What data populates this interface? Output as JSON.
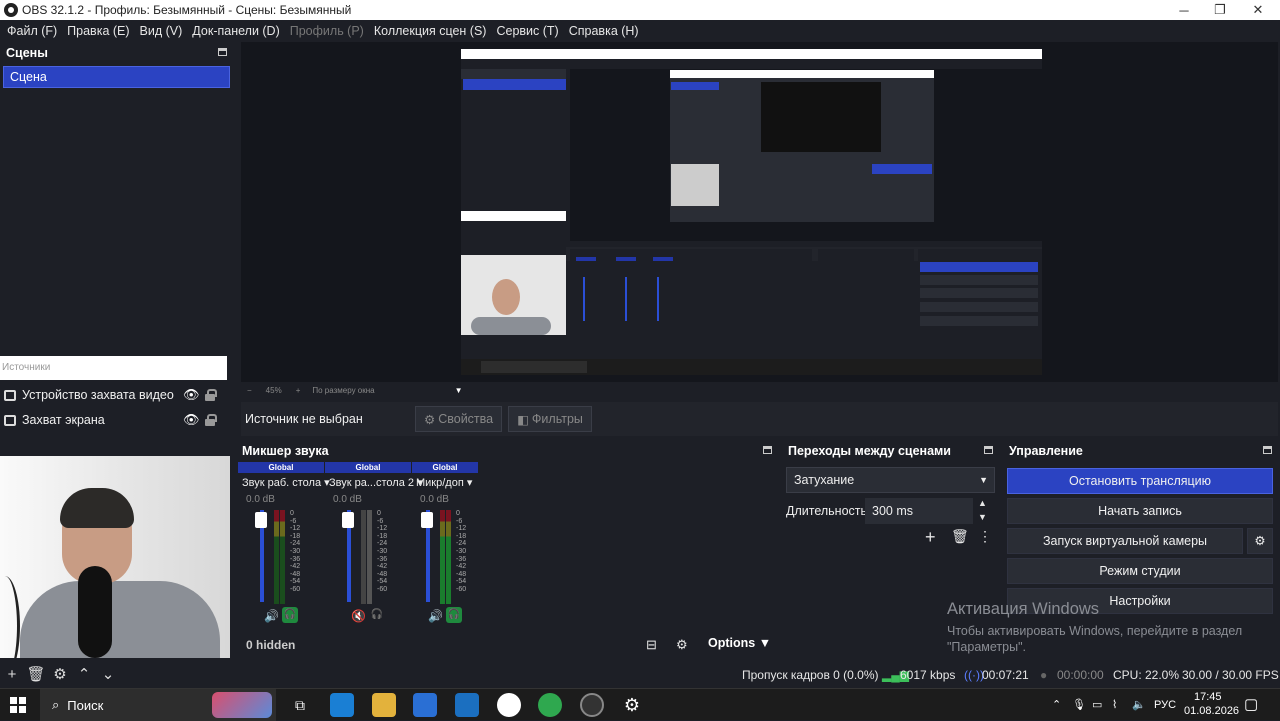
{
  "window": {
    "title": "OBS 32.1.2 - Профиль: Безымянный - Сцены: Безымянный",
    "minimize": "─",
    "maximize": "❐",
    "close": "✕"
  },
  "menu": [
    {
      "label": "Файл (F)"
    },
    {
      "label": "Правка (E)"
    },
    {
      "label": "Вид (V)"
    },
    {
      "label": "Док-панели (D)"
    },
    {
      "label": "Профиль (P)",
      "disabled": true
    },
    {
      "label": "Коллекция сцен (S)"
    },
    {
      "label": "Сервис (T)"
    },
    {
      "label": "Справка (H)"
    }
  ],
  "scenes": {
    "title": "Сцены",
    "items": [
      "Сцена"
    ]
  },
  "sources": {
    "title": "Источники",
    "items": [
      {
        "label": "Устройство захвата видео",
        "icon": "camera-icon"
      },
      {
        "label": "Захват экрана",
        "icon": "monitor-icon"
      }
    ]
  },
  "preview": {
    "zoom": "45%",
    "fit": "По размеру окна"
  },
  "source_bar": {
    "none": "Источник не выбран",
    "properties": "Свойства",
    "filters": "Фильтры"
  },
  "mixer": {
    "title": "Микшер звука",
    "channels": [
      {
        "tag": "Global",
        "name": "Звук раб. стола",
        "db": "0.0 dB",
        "monitor": true
      },
      {
        "tag": "Global",
        "name": "Звук ра...стола 2",
        "db": "0.0 dB",
        "monitor": false
      },
      {
        "tag": "Global",
        "name": "Микр/доп",
        "db": "0.0 dB",
        "monitor": true
      }
    ],
    "scale": [
      "0",
      "-6",
      "-12",
      "-18",
      "-24",
      "-30",
      "-36",
      "-42",
      "-48",
      "-54",
      "-60"
    ],
    "hidden": "0 hidden",
    "options": "Options"
  },
  "transitions": {
    "title": "Переходы между сценами",
    "type": "Затухание",
    "duration_label": "Длительность",
    "duration": "300 ms"
  },
  "controls": {
    "title": "Управление",
    "stop_stream": "Остановить трансляцию",
    "start_record": "Начать запись",
    "virtual_cam": "Запуск виртуальной камеры",
    "studio": "Режим студии",
    "settings": "Настройки"
  },
  "watermark": {
    "title": "Активация Windows",
    "text": "Чтобы активировать Windows, перейдите в раздел \"Параметры\"."
  },
  "status": {
    "dropped": "Пропуск кадров 0 (0.0%)",
    "bitrate": "6017 kbps",
    "stream_time": "00:07:21",
    "rec_time": "00:00:00",
    "cpu": "CPU: 22.0%",
    "fps": "30.00 / 30.00 FPS"
  },
  "taskbar": {
    "search": "Поиск",
    "lang": "РУС",
    "time": "17:45",
    "date": "01.08.2026"
  },
  "colors": {
    "accent": "#2b43c2",
    "bg": "#1d1f26",
    "meter_green": "#1f8a3e"
  }
}
